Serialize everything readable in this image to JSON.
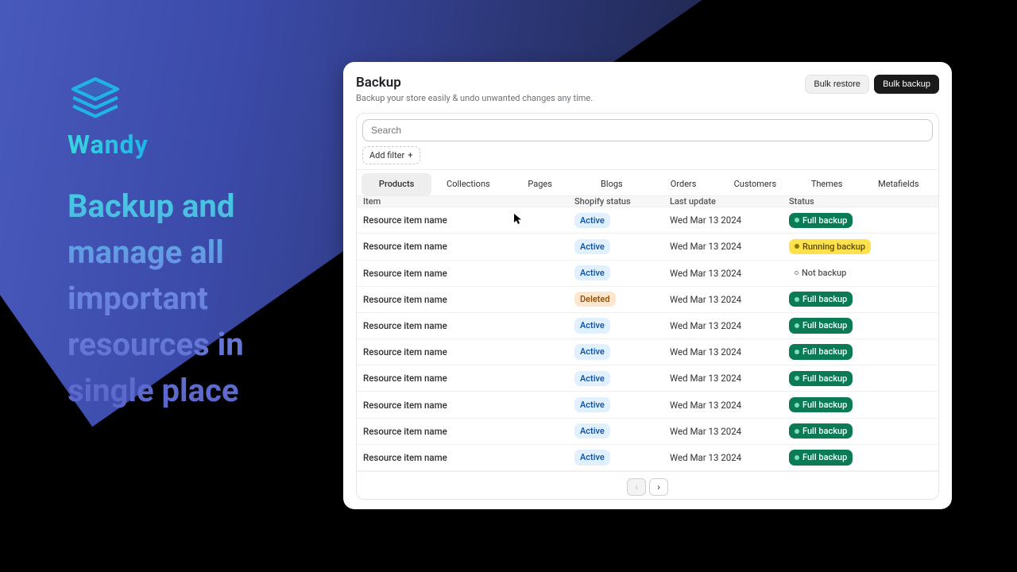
{
  "hero": {
    "brand": "Wandy",
    "tagline": "Backup and manage all important resources in single place"
  },
  "panel": {
    "title": "Backup",
    "subtitle": "Backup your store easily & undo unwanted changes any time.",
    "bulk_restore": "Bulk restore",
    "bulk_backup": "Bulk backup"
  },
  "search": {
    "placeholder": "Search"
  },
  "filter": {
    "add": "Add filter"
  },
  "tabs": [
    "Products",
    "Collections",
    "Pages",
    "Blogs",
    "Orders",
    "Customers",
    "Themes",
    "Metafields"
  ],
  "active_tab": 0,
  "columns": {
    "item": "Item",
    "shop_status": "Shopify status",
    "updated": "Last update",
    "status": "Status"
  },
  "status_labels": {
    "active": "Active",
    "deleted": "Deleted",
    "full": "Full backup",
    "running": "Running backup",
    "not": "Not backup"
  },
  "rows": [
    {
      "name": "Resource item name",
      "shop": "active",
      "date": "Wed Mar 13 2024",
      "status": "full"
    },
    {
      "name": "Resource item name",
      "shop": "active",
      "date": "Wed Mar 13 2024",
      "status": "running"
    },
    {
      "name": "Resource item name",
      "shop": "active",
      "date": "Wed Mar 13 2024",
      "status": "not"
    },
    {
      "name": "Resource item name",
      "shop": "deleted",
      "date": "Wed Mar 13 2024",
      "status": "full"
    },
    {
      "name": "Resource item name",
      "shop": "active",
      "date": "Wed Mar 13 2024",
      "status": "full"
    },
    {
      "name": "Resource item name",
      "shop": "active",
      "date": "Wed Mar 13 2024",
      "status": "full"
    },
    {
      "name": "Resource item name",
      "shop": "active",
      "date": "Wed Mar 13 2024",
      "status": "full"
    },
    {
      "name": "Resource item name",
      "shop": "active",
      "date": "Wed Mar 13 2024",
      "status": "full"
    },
    {
      "name": "Resource item name",
      "shop": "active",
      "date": "Wed Mar 13 2024",
      "status": "full"
    },
    {
      "name": "Resource item name",
      "shop": "active",
      "date": "Wed Mar 13 2024",
      "status": "full"
    }
  ]
}
